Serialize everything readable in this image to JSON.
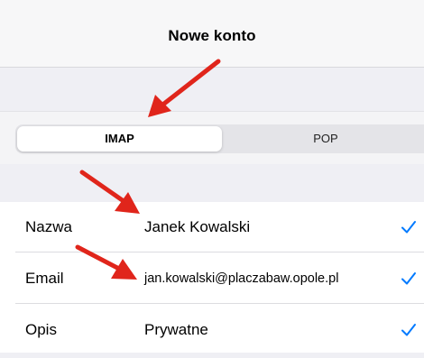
{
  "nav": {
    "title": "Nowe konto"
  },
  "account_type": {
    "options": [
      "IMAP",
      "POP"
    ],
    "selected": "IMAP"
  },
  "form": {
    "rows": [
      {
        "label": "Nazwa",
        "value": "Janek Kowalski",
        "valid": true
      },
      {
        "label": "Email",
        "value": "jan.kowalski@placzabaw.opole.pl",
        "valid": true
      },
      {
        "label": "Opis",
        "value": "Prywatne",
        "valid": true
      }
    ]
  },
  "colors": {
    "accent": "#007aff",
    "annotation_arrow": "#e0251b",
    "background": "#efeff4"
  },
  "icons": {
    "valid": "checkmark-icon",
    "annotation": "red-arrow-icon"
  }
}
